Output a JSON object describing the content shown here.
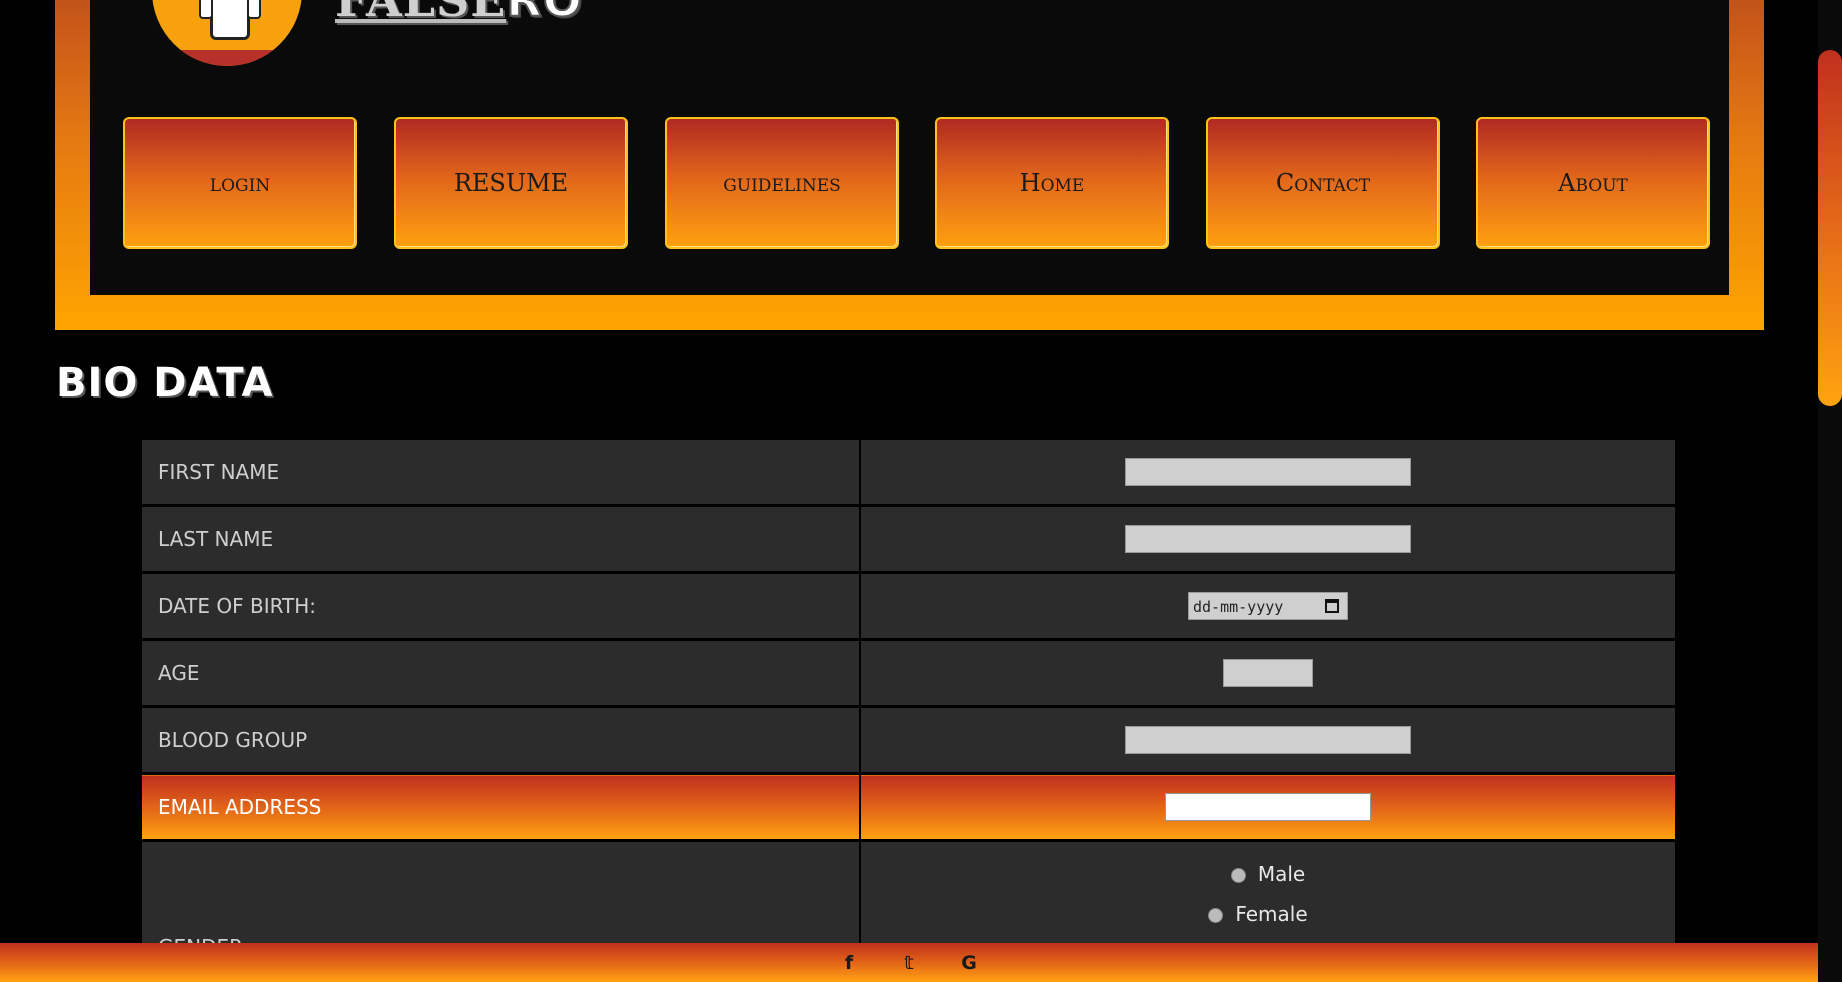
{
  "header": {
    "logo_text_left": "FALSE",
    "logo_text_right": "RO",
    "nav": [
      {
        "label": "login"
      },
      {
        "label": "RESUME"
      },
      {
        "label": "guidelines"
      },
      {
        "label": "Home"
      },
      {
        "label": "Contact"
      },
      {
        "label": "About"
      }
    ]
  },
  "form": {
    "title": "BIO DATA",
    "rows": [
      {
        "label": "FIRST NAME"
      },
      {
        "label": "LAST NAME"
      },
      {
        "label": "DATE OF BIRTH:",
        "placeholder": "dd-mm-yyyy"
      },
      {
        "label": "AGE"
      },
      {
        "label": "BLOOD GROUP"
      },
      {
        "label": "EMAIL ADDRESS"
      },
      {
        "label": "GENDER",
        "options": [
          "Male",
          "Female"
        ]
      }
    ]
  },
  "footer": {
    "icons": [
      "facebook-icon",
      "twitter-icon",
      "google-icon"
    ],
    "glyphs": [
      "f",
      "𝕥",
      "G"
    ]
  },
  "colors": {
    "accent_orange": "#ffa500",
    "accent_red": "#b02a22",
    "row_bg": "#2c2c2c"
  }
}
